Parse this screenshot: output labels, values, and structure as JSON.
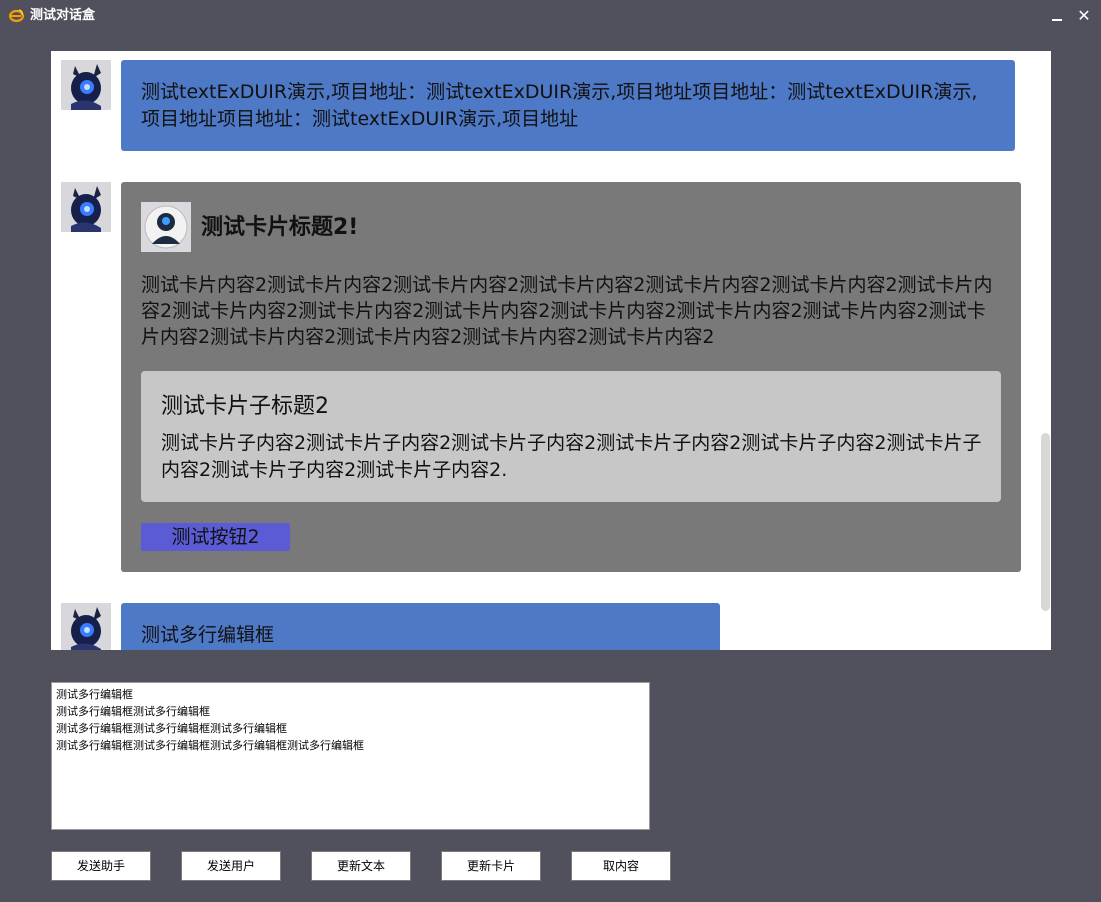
{
  "window": {
    "title": "测试对话盒",
    "minimize_label": "",
    "close_label": "✕"
  },
  "messages": [
    {
      "type": "text",
      "text": "测试textExDUIR演示,项目地址：测试textExDUIR演示,项目地址项目地址：测试textExDUIR演示,项目地址项目地址：测试textExDUIR演示,项目地址"
    },
    {
      "type": "card",
      "title": "测试卡片标题2!",
      "content": "测试卡片内容2测试卡片内容2测试卡片内容2测试卡片内容2测试卡片内容2测试卡片内容2测试卡片内容2测试卡片内容2测试卡片内容2测试卡片内容2测试卡片内容2测试卡片内容2测试卡片内容2测试卡片内容2测试卡片内容2测试卡片内容2测试卡片内容2测试卡片内容2",
      "sub_title": "测试卡片子标题2",
      "sub_content": "测试卡片子内容2测试卡片子内容2测试卡片子内容2测试卡片子内容2测试卡片子内容2测试卡片子内容2测试卡片子内容2测试卡片子内容2.",
      "button_label": "测试按钮2"
    },
    {
      "type": "text",
      "text": "测试多行编辑框"
    }
  ],
  "editor": {
    "lines": [
      "测试多行编辑框",
      "测试多行编辑框测试多行编辑框",
      "测试多行编辑框测试多行编辑框测试多行编辑框",
      "测试多行编辑框测试多行编辑框测试多行编辑框测试多行编辑框"
    ]
  },
  "buttons": {
    "send_assistant": "发送助手",
    "send_user": "发送用户",
    "update_text": "更新文本",
    "update_card": "更新卡片",
    "get_content": "取内容"
  },
  "colors": {
    "window_bg": "#50515c",
    "bubble_blue": "#4e79c6",
    "card_bg": "#797979",
    "sub_card_bg": "#c7c7c7",
    "card_button": "#5b5bd6"
  }
}
